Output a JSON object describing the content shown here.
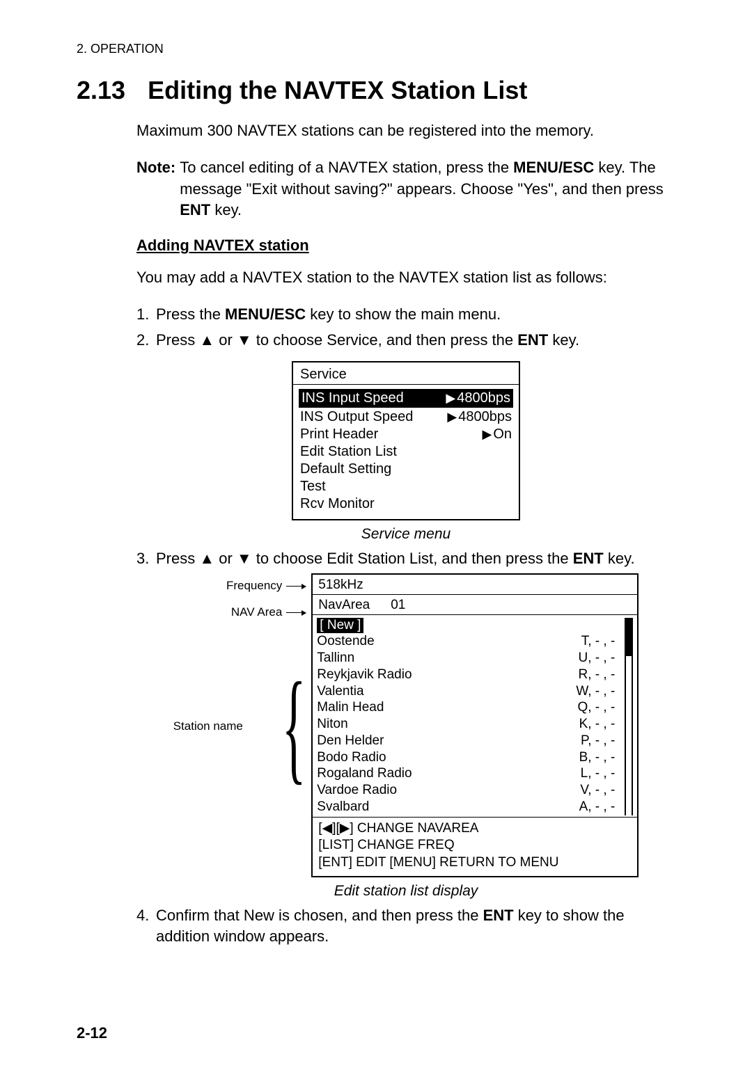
{
  "chapter_header": "2.  OPERATION",
  "section": {
    "number": "2.13",
    "title": "Editing the NAVTEX Station List"
  },
  "intro": "Maximum 300 NAVTEX stations can be registered into the memory.",
  "note": {
    "label": "Note:",
    "line1": " To cancel editing of a NAVTEX station, press the ",
    "key1": "MENU/ESC",
    "line2": " key. The message \"Exit without saving?\" appears. Choose \"Yes\", and then press ",
    "key2": "ENT",
    "line3": " key."
  },
  "adding": {
    "heading": "Adding NAVTEX station",
    "intro": "You may add a NAVTEX station to the NAVTEX station list as follows:",
    "step1": {
      "n": "1.",
      "a": "Press the ",
      "b": "MENU/ESC",
      "c": " key to show the main menu."
    },
    "step2": {
      "n": "2.",
      "a": "Press ▲ or ▼ to choose Service, and then press the ",
      "b": "ENT",
      "c": " key."
    },
    "step3": {
      "n": "3.",
      "a": "Press ▲ or ▼ to choose Edit Station List, and then press the ",
      "b": "ENT",
      "c": " key."
    },
    "step4": {
      "n": "4.",
      "a": "Confirm that New is chosen, and then press the ",
      "b": "ENT",
      "c": " key to show the addition window appears."
    }
  },
  "service_menu": {
    "title": "Service",
    "caption": "Service menu",
    "rows": [
      {
        "label": "INS Input Speed",
        "value": "4800bps",
        "selected": true
      },
      {
        "label": "INS Output Speed",
        "value": "4800bps",
        "selected": false
      },
      {
        "label": "Print Header",
        "value": "On",
        "selected": false
      },
      {
        "label": "Edit Station List",
        "value": "",
        "selected": false
      },
      {
        "label": "Default Setting",
        "value": "",
        "selected": false
      },
      {
        "label": "Test",
        "value": "",
        "selected": false
      },
      {
        "label": "Rcv Monitor",
        "value": "",
        "selected": false
      }
    ]
  },
  "edit_labels": {
    "frequency": "Frequency",
    "nav_area": "NAV Area",
    "station_name": "Station name"
  },
  "edit_display": {
    "caption": "Edit station list display",
    "frequency": "518kHz",
    "navarea_label": "NavArea",
    "navarea_value": "01",
    "new_label": "[ New ]",
    "stations": [
      {
        "name": "Oostende",
        "code": "T,  - , -"
      },
      {
        "name": "Tallinn",
        "code": "U,  - , -"
      },
      {
        "name": "Reykjavik Radio",
        "code": "R,  - , -"
      },
      {
        "name": "Valentia",
        "code": "W, - , -"
      },
      {
        "name": "Malin Head",
        "code": "Q, - , -"
      },
      {
        "name": "Niton",
        "code": "K,  - , -"
      },
      {
        "name": "Den Helder",
        "code": "P,  - , -"
      },
      {
        "name": "Bodo Radio",
        "code": "B,  - , -"
      },
      {
        "name": "Rogaland Radio",
        "code": "L,  - , -"
      },
      {
        "name": "Vardoe Radio",
        "code": "V,  - , -"
      },
      {
        "name": "Svalbard",
        "code": "A,  - , -"
      }
    ],
    "help": {
      "line1": "[◀][▶] CHANGE NAVAREA",
      "line2": "[LIST] CHANGE FREQ",
      "line3": "[ENT] EDIT    [MENU] RETURN TO MENU"
    }
  },
  "page_number": "2-12"
}
